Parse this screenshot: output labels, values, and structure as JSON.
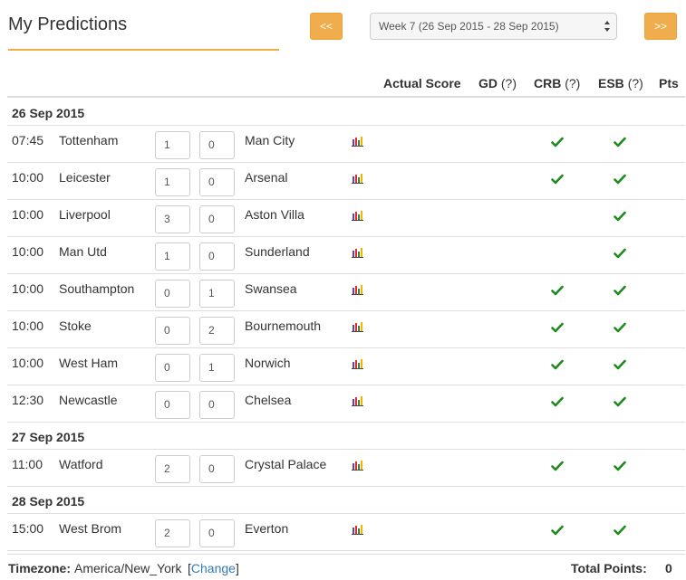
{
  "header": {
    "title": "My Predictions",
    "prev_label": "<<",
    "next_label": ">>",
    "week_selected": "Week 7 (26 Sep 2015 - 28 Sep 2015)"
  },
  "columns": {
    "actual_score": "Actual Score",
    "gd": "GD",
    "crb": "CRB",
    "esb": "ESB",
    "help": "(?)",
    "pts": "Pts"
  },
  "days": [
    {
      "date": "26 Sep 2015",
      "matches": [
        {
          "time": "07:45",
          "home": "Tottenham",
          "home_pred": "1",
          "away_pred": "0",
          "away": "Man City",
          "crb": true,
          "esb": true
        },
        {
          "time": "10:00",
          "home": "Leicester",
          "home_pred": "1",
          "away_pred": "0",
          "away": "Arsenal",
          "crb": true,
          "esb": true
        },
        {
          "time": "10:00",
          "home": "Liverpool",
          "home_pred": "3",
          "away_pred": "0",
          "away": "Aston Villa",
          "crb": false,
          "esb": true
        },
        {
          "time": "10:00",
          "home": "Man Utd",
          "home_pred": "1",
          "away_pred": "0",
          "away": "Sunderland",
          "crb": false,
          "esb": true
        },
        {
          "time": "10:00",
          "home": "Southampton",
          "home_pred": "0",
          "away_pred": "1",
          "away": "Swansea",
          "crb": true,
          "esb": true
        },
        {
          "time": "10:00",
          "home": "Stoke",
          "home_pred": "0",
          "away_pred": "2",
          "away": "Bournemouth",
          "crb": true,
          "esb": true
        },
        {
          "time": "10:00",
          "home": "West Ham",
          "home_pred": "0",
          "away_pred": "1",
          "away": "Norwich",
          "crb": true,
          "esb": true
        },
        {
          "time": "12:30",
          "home": "Newcastle",
          "home_pred": "0",
          "away_pred": "0",
          "away": "Chelsea",
          "crb": true,
          "esb": true
        }
      ]
    },
    {
      "date": "27 Sep 2015",
      "matches": [
        {
          "time": "11:00",
          "home": "Watford",
          "home_pred": "2",
          "away_pred": "0",
          "away": "Crystal Palace",
          "crb": true,
          "esb": true
        }
      ]
    },
    {
      "date": "28 Sep 2015",
      "matches": [
        {
          "time": "15:00",
          "home": "West Brom",
          "home_pred": "2",
          "away_pred": "0",
          "away": "Everton",
          "crb": true,
          "esb": true
        }
      ]
    }
  ],
  "footer": {
    "timezone_label": "Timezone:",
    "timezone_value": "America/New_York",
    "bracket_open": "[",
    "change_label": "Change",
    "bracket_close": "]",
    "total_label": "Total Points:",
    "total_value": "0"
  },
  "colors": {
    "accent": "#f0ad4e",
    "check": "#1f8a1f",
    "link": "#337ab7",
    "border": "#dddddd"
  },
  "icons": {
    "stats": "bar-chart-icon",
    "check": "check-icon"
  }
}
